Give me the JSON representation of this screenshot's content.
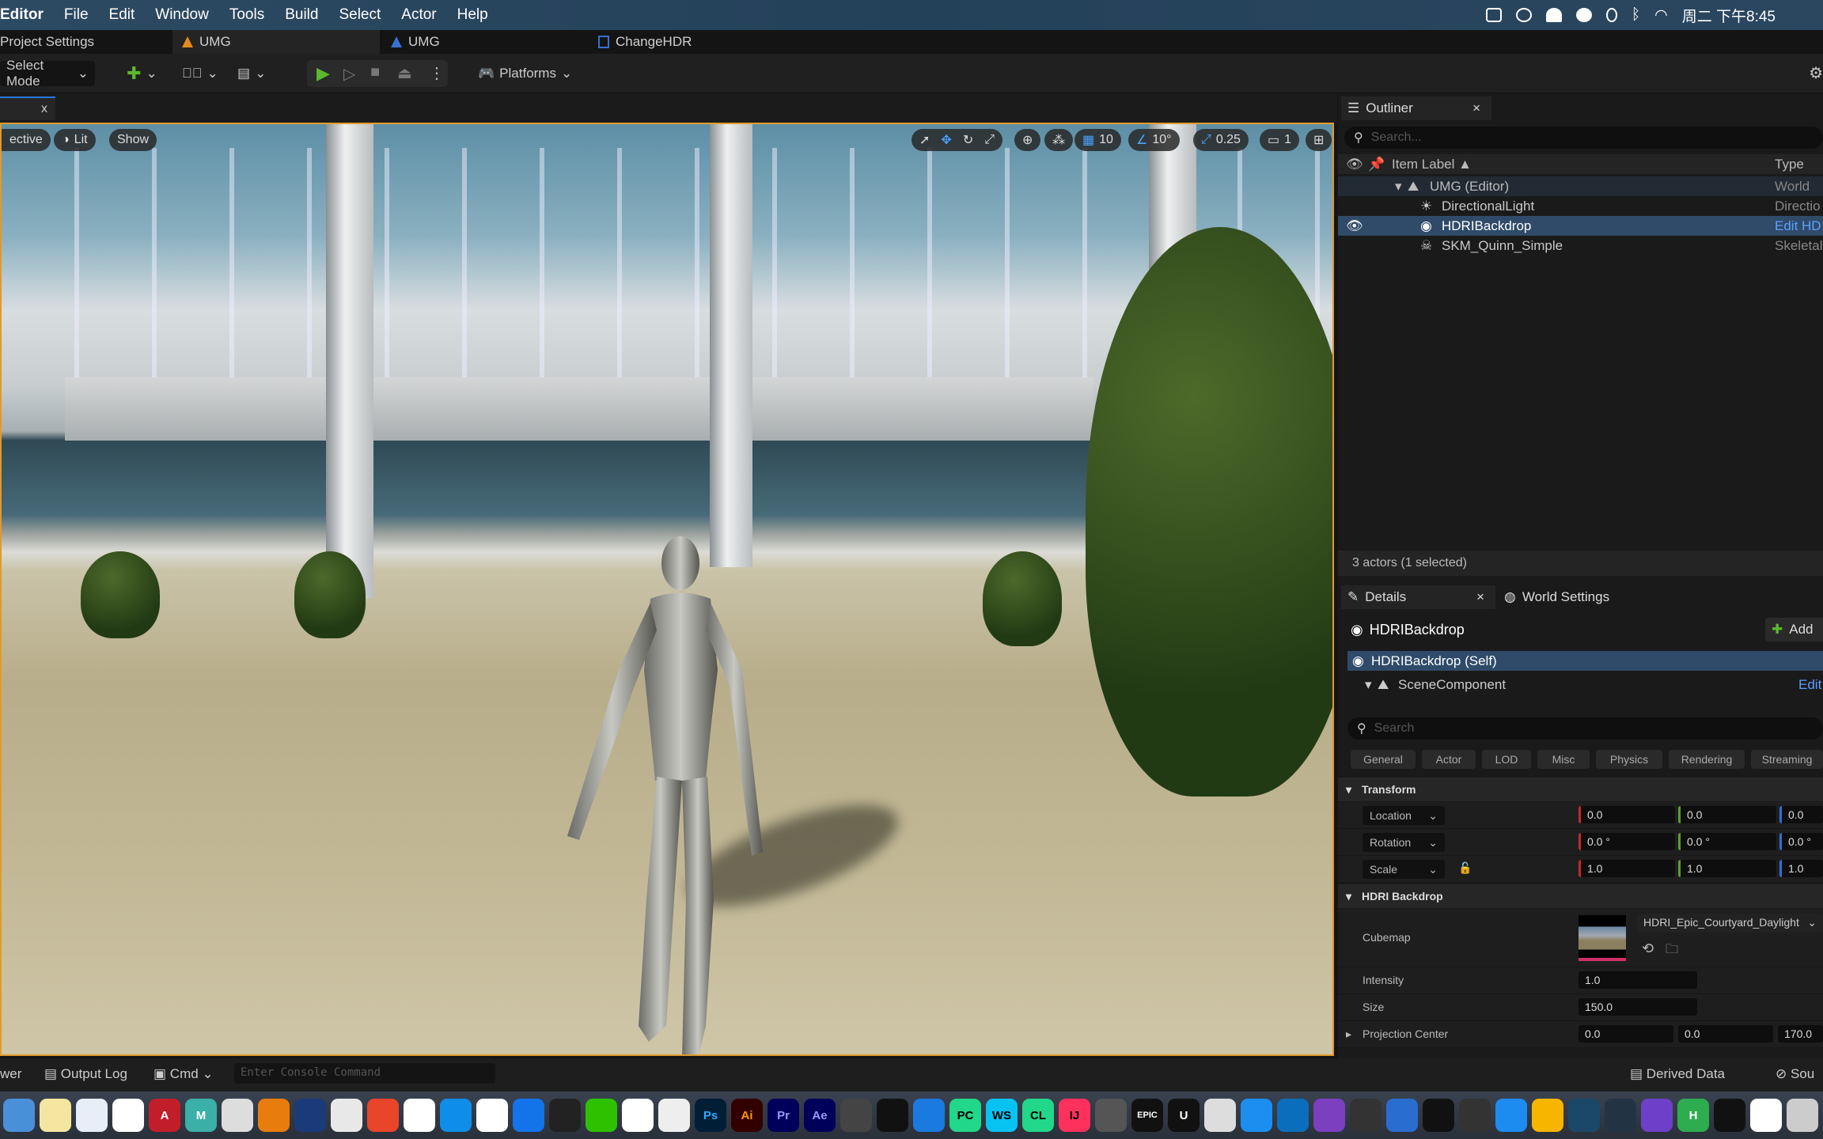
{
  "menubar": {
    "app": "Editor",
    "items": [
      "File",
      "Edit",
      "Window",
      "Tools",
      "Build",
      "Select",
      "Actor",
      "Help"
    ],
    "clock": "周二 下午8:45",
    "status_icons": [
      "screen-record-icon",
      "creative-cloud-icon",
      "qq-icon",
      "wechat-icon",
      "vpn-icon",
      "bluetooth-icon",
      "wifi-icon"
    ]
  },
  "doc_tabs": [
    {
      "label": "Project Settings"
    },
    {
      "label": "UMG",
      "icon": "level-icon",
      "active": true
    },
    {
      "label": "UMG",
      "icon": "blueprint-icon"
    },
    {
      "label": "ChangeHDR",
      "icon": "widget-icon"
    }
  ],
  "toolbar": {
    "select_mode": "Select Mode",
    "platforms": "Platforms"
  },
  "viewport": {
    "tab_close": "x",
    "perspective": "ective",
    "lit": "Lit",
    "show": "Show",
    "grid_snap": "10",
    "rot_snap": "10°",
    "scale_snap": "0.25",
    "camera_speed": "1"
  },
  "outliner": {
    "title": "Outliner",
    "close": "×",
    "search_placeholder": "Search...",
    "col_label": "Item Label ▲",
    "col_type": "Type",
    "rows": [
      {
        "label": "UMG (Editor)",
        "type": "World",
        "icon": "level-icon"
      },
      {
        "label": "DirectionalLight",
        "type": "Directio",
        "icon": "directional-light-icon"
      },
      {
        "label": "HDRIBackdrop",
        "type": "Edit HD",
        "icon": "hdri-icon",
        "selected": true
      },
      {
        "label": "SKM_Quinn_Simple",
        "type": "Skeletal",
        "icon": "skeletal-mesh-icon"
      }
    ],
    "footer": "3 actors (1 selected)"
  },
  "details": {
    "title": "Details",
    "close": "×",
    "world_settings": "World Settings",
    "actor": "HDRIBackdrop",
    "add": "Add",
    "self": "HDRIBackdrop (Self)",
    "component": "SceneComponent",
    "edit": "Edit",
    "search_placeholder": "Search",
    "filters": [
      "General",
      "Actor",
      "LOD",
      "Misc",
      "Physics",
      "Rendering",
      "Streaming"
    ],
    "transform": {
      "title": "Transform",
      "location": {
        "label": "Location",
        "x": "0.0",
        "y": "0.0",
        "z": "0.0"
      },
      "rotation": {
        "label": "Rotation",
        "x": "0.0 °",
        "y": "0.0 °",
        "z": "0.0 °"
      },
      "scale": {
        "label": "Scale",
        "x": "1.0",
        "y": "1.0",
        "z": "1.0"
      }
    },
    "hdri": {
      "title": "HDRI Backdrop",
      "cubemap_label": "Cubemap",
      "cubemap": "HDRI_Epic_Courtyard_Daylight",
      "intensity_label": "Intensity",
      "intensity": "1.0",
      "size_label": "Size",
      "size": "150.0",
      "proj_label": "Projection Center",
      "proj_x": "0.0",
      "proj_y": "0.0",
      "proj_z": "170.0"
    }
  },
  "bottombar": {
    "browser": "wer",
    "output_log": "Output Log",
    "cmd": "Cmd",
    "console_placeholder": "Enter Console Command",
    "derived_data": "Derived Data",
    "source": "Sou"
  },
  "dock": [
    {
      "n": "finder",
      "c": "#4a90d9"
    },
    {
      "n": "notes",
      "c": "#f4e6a0"
    },
    {
      "n": "keynote",
      "c": "#e8eef8"
    },
    {
      "n": "baidu-netdisk",
      "c": "#fff"
    },
    {
      "n": "autocad",
      "c": "#c21e2a",
      "t": "A"
    },
    {
      "n": "maya",
      "c": "#3ab0a8",
      "t": "M"
    },
    {
      "n": "zbrush",
      "c": "#ddd"
    },
    {
      "n": "blender",
      "c": "#e87d0d"
    },
    {
      "n": "cinema4d",
      "c": "#1a3a7a"
    },
    {
      "n": "messages",
      "c": "#e8e8e8"
    },
    {
      "n": "xmind",
      "c": "#e8452a"
    },
    {
      "n": "xcode-x",
      "c": "#fff"
    },
    {
      "n": "teamviewer",
      "c": "#0e8ee9"
    },
    {
      "n": "lark",
      "c": "#fff"
    },
    {
      "n": "tencent-meeting",
      "c": "#1273eb"
    },
    {
      "n": "qq",
      "c": "#222"
    },
    {
      "n": "wechat",
      "c": "#2dc100"
    },
    {
      "n": "wps",
      "c": "#fff"
    },
    {
      "n": "chrome",
      "c": "#eee"
    },
    {
      "n": "photoshop",
      "c": "#001e36",
      "t": "Ps",
      "tc": "#31a8ff"
    },
    {
      "n": "illustrator",
      "c": "#330000",
      "t": "Ai",
      "tc": "#ff9a00"
    },
    {
      "n": "premiere",
      "c": "#00005b",
      "t": "Pr",
      "tc": "#9999ff"
    },
    {
      "n": "after-effects",
      "c": "#00005b",
      "t": "Ae",
      "tc": "#9999ff"
    },
    {
      "n": "final-cut",
      "c": "#444"
    },
    {
      "n": "capcut",
      "c": "#111"
    },
    {
      "n": "xcode",
      "c": "#1a7ae0"
    },
    {
      "n": "pycharm",
      "c": "#21d789",
      "t": "PC",
      "tc": "#000"
    },
    {
      "n": "webstorm",
      "c": "#07c3f2",
      "t": "WS",
      "tc": "#000"
    },
    {
      "n": "clion",
      "c": "#21d789",
      "t": "CL",
      "tc": "#000"
    },
    {
      "n": "intellij",
      "c": "#fe315d",
      "t": "IJ",
      "tc": "#000"
    },
    {
      "n": "unity",
      "c": "#555"
    },
    {
      "n": "epic-games",
      "c": "#111",
      "t": "EPIC"
    },
    {
      "n": "unreal-engine",
      "c": "#111",
      "t": "U"
    },
    {
      "n": "affinity",
      "c": "#ddd"
    },
    {
      "n": "bezel",
      "c": "#1c8ef0"
    },
    {
      "n": "vscode",
      "c": "#0a6ebd"
    },
    {
      "n": "visual-studio",
      "c": "#7b3fc0"
    },
    {
      "n": "sublime",
      "c": "#333"
    },
    {
      "n": "remote-desktop",
      "c": "#2a6dd0"
    },
    {
      "n": "terminal",
      "c": "#111"
    },
    {
      "n": "instruments",
      "c": "#333"
    },
    {
      "n": "finder-alt",
      "c": "#1d8cf0"
    },
    {
      "n": "sketch",
      "c": "#f7b500"
    },
    {
      "n": "mysql-workbench",
      "c": "#1b4868"
    },
    {
      "n": "proxyman",
      "c": "#234"
    },
    {
      "n": "github-desktop",
      "c": "#6e40c9"
    },
    {
      "n": "hbuilder",
      "c": "#2dad4f",
      "t": "H"
    },
    {
      "n": "circle-app",
      "c": "#111"
    },
    {
      "n": "evernote",
      "c": "#fff"
    },
    {
      "n": "photo-app",
      "c": "#ccc"
    }
  ]
}
